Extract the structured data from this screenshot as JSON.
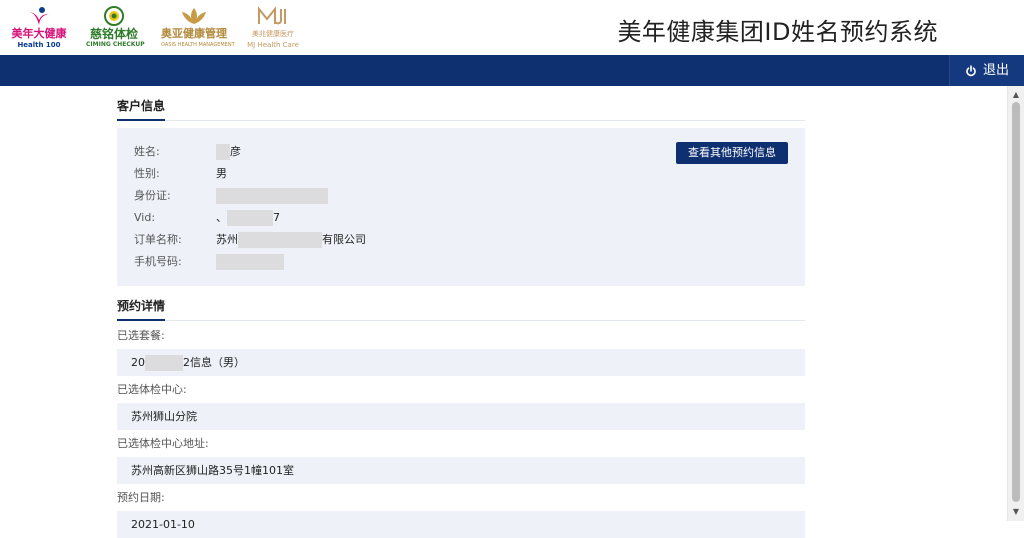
{
  "header": {
    "logos": [
      {
        "cn": "美年大健康",
        "en": "Health 100"
      },
      {
        "cn": "慈铭体检",
        "en": "CIMING CHECKUP"
      },
      {
        "cn": "奥亚健康管理",
        "en": "OASIS HEALTH MANAGEMENT"
      },
      {
        "cn": "美兆健康医疗",
        "en": "MJ Health Care"
      }
    ],
    "system_title": "美年健康集团ID姓名预约系统"
  },
  "navbar": {
    "logout_label": "退出",
    "logout_icon": "power-icon"
  },
  "customer": {
    "section_title": "客户信息",
    "other_button_label": "查看其他预约信息",
    "fields": [
      {
        "label": "姓名:",
        "value_prefix": "",
        "value_suffix": "彦"
      },
      {
        "label": "性别:",
        "value_prefix": "男",
        "value_suffix": ""
      },
      {
        "label": "身份证:",
        "value_prefix": "",
        "value_suffix": ""
      },
      {
        "label": "Vid:",
        "value_prefix": "、",
        "value_suffix": "7"
      },
      {
        "label": "订单名称:",
        "value_prefix": "苏州",
        "value_suffix": "有限公司"
      },
      {
        "label": "手机号码:",
        "value_prefix": "",
        "value_suffix": ""
      }
    ]
  },
  "booking": {
    "section_title": "预约详情",
    "package_label": "已选套餐:",
    "package_value_prefix": "20",
    "package_value_suffix": "2信息（男）",
    "center_label": "已选体检中心:",
    "center_value": "苏州狮山分院",
    "address_label": "已选体检中心地址:",
    "address_value": "苏州高新区狮山路35号1幢101室",
    "date_label": "预约日期:",
    "date_value": "2021-01-10"
  },
  "colors": {
    "primary": "#0f3070",
    "panel": "#eef2f8"
  }
}
